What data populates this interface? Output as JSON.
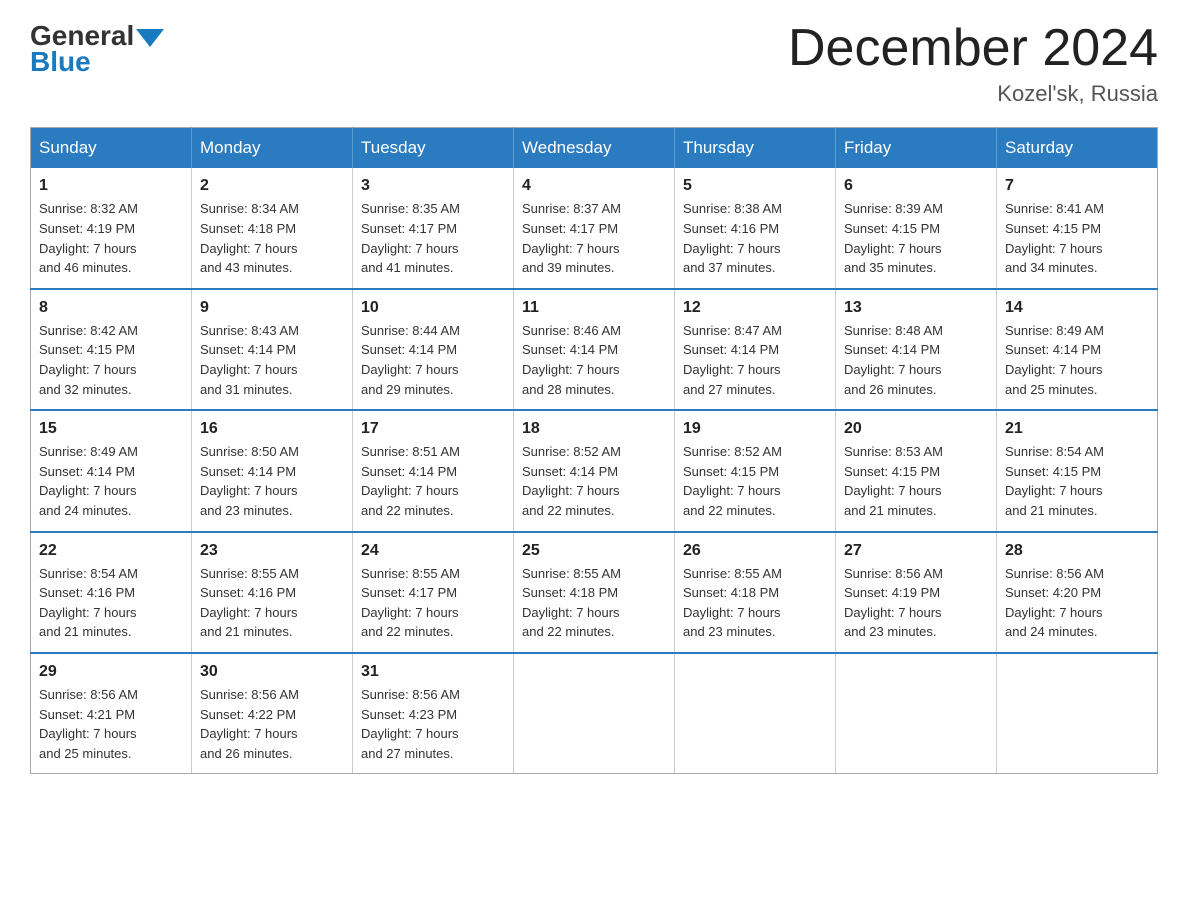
{
  "logo": {
    "general": "General",
    "blue": "Blue"
  },
  "header": {
    "month_year": "December 2024",
    "location": "Kozel'sk, Russia"
  },
  "weekdays": [
    "Sunday",
    "Monday",
    "Tuesday",
    "Wednesday",
    "Thursday",
    "Friday",
    "Saturday"
  ],
  "weeks": [
    [
      {
        "day": "1",
        "sunrise": "8:32 AM",
        "sunset": "4:19 PM",
        "daylight": "7 hours and 46 minutes."
      },
      {
        "day": "2",
        "sunrise": "8:34 AM",
        "sunset": "4:18 PM",
        "daylight": "7 hours and 43 minutes."
      },
      {
        "day": "3",
        "sunrise": "8:35 AM",
        "sunset": "4:17 PM",
        "daylight": "7 hours and 41 minutes."
      },
      {
        "day": "4",
        "sunrise": "8:37 AM",
        "sunset": "4:17 PM",
        "daylight": "7 hours and 39 minutes."
      },
      {
        "day": "5",
        "sunrise": "8:38 AM",
        "sunset": "4:16 PM",
        "daylight": "7 hours and 37 minutes."
      },
      {
        "day": "6",
        "sunrise": "8:39 AM",
        "sunset": "4:15 PM",
        "daylight": "7 hours and 35 minutes."
      },
      {
        "day": "7",
        "sunrise": "8:41 AM",
        "sunset": "4:15 PM",
        "daylight": "7 hours and 34 minutes."
      }
    ],
    [
      {
        "day": "8",
        "sunrise": "8:42 AM",
        "sunset": "4:15 PM",
        "daylight": "7 hours and 32 minutes."
      },
      {
        "day": "9",
        "sunrise": "8:43 AM",
        "sunset": "4:14 PM",
        "daylight": "7 hours and 31 minutes."
      },
      {
        "day": "10",
        "sunrise": "8:44 AM",
        "sunset": "4:14 PM",
        "daylight": "7 hours and 29 minutes."
      },
      {
        "day": "11",
        "sunrise": "8:46 AM",
        "sunset": "4:14 PM",
        "daylight": "7 hours and 28 minutes."
      },
      {
        "day": "12",
        "sunrise": "8:47 AM",
        "sunset": "4:14 PM",
        "daylight": "7 hours and 27 minutes."
      },
      {
        "day": "13",
        "sunrise": "8:48 AM",
        "sunset": "4:14 PM",
        "daylight": "7 hours and 26 minutes."
      },
      {
        "day": "14",
        "sunrise": "8:49 AM",
        "sunset": "4:14 PM",
        "daylight": "7 hours and 25 minutes."
      }
    ],
    [
      {
        "day": "15",
        "sunrise": "8:49 AM",
        "sunset": "4:14 PM",
        "daylight": "7 hours and 24 minutes."
      },
      {
        "day": "16",
        "sunrise": "8:50 AM",
        "sunset": "4:14 PM",
        "daylight": "7 hours and 23 minutes."
      },
      {
        "day": "17",
        "sunrise": "8:51 AM",
        "sunset": "4:14 PM",
        "daylight": "7 hours and 22 minutes."
      },
      {
        "day": "18",
        "sunrise": "8:52 AM",
        "sunset": "4:14 PM",
        "daylight": "7 hours and 22 minutes."
      },
      {
        "day": "19",
        "sunrise": "8:52 AM",
        "sunset": "4:15 PM",
        "daylight": "7 hours and 22 minutes."
      },
      {
        "day": "20",
        "sunrise": "8:53 AM",
        "sunset": "4:15 PM",
        "daylight": "7 hours and 21 minutes."
      },
      {
        "day": "21",
        "sunrise": "8:54 AM",
        "sunset": "4:15 PM",
        "daylight": "7 hours and 21 minutes."
      }
    ],
    [
      {
        "day": "22",
        "sunrise": "8:54 AM",
        "sunset": "4:16 PM",
        "daylight": "7 hours and 21 minutes."
      },
      {
        "day": "23",
        "sunrise": "8:55 AM",
        "sunset": "4:16 PM",
        "daylight": "7 hours and 21 minutes."
      },
      {
        "day": "24",
        "sunrise": "8:55 AM",
        "sunset": "4:17 PM",
        "daylight": "7 hours and 22 minutes."
      },
      {
        "day": "25",
        "sunrise": "8:55 AM",
        "sunset": "4:18 PM",
        "daylight": "7 hours and 22 minutes."
      },
      {
        "day": "26",
        "sunrise": "8:55 AM",
        "sunset": "4:18 PM",
        "daylight": "7 hours and 23 minutes."
      },
      {
        "day": "27",
        "sunrise": "8:56 AM",
        "sunset": "4:19 PM",
        "daylight": "7 hours and 23 minutes."
      },
      {
        "day": "28",
        "sunrise": "8:56 AM",
        "sunset": "4:20 PM",
        "daylight": "7 hours and 24 minutes."
      }
    ],
    [
      {
        "day": "29",
        "sunrise": "8:56 AM",
        "sunset": "4:21 PM",
        "daylight": "7 hours and 25 minutes."
      },
      {
        "day": "30",
        "sunrise": "8:56 AM",
        "sunset": "4:22 PM",
        "daylight": "7 hours and 26 minutes."
      },
      {
        "day": "31",
        "sunrise": "8:56 AM",
        "sunset": "4:23 PM",
        "daylight": "7 hours and 27 minutes."
      },
      null,
      null,
      null,
      null
    ]
  ],
  "labels": {
    "sunrise": "Sunrise:",
    "sunset": "Sunset:",
    "daylight": "Daylight:"
  }
}
